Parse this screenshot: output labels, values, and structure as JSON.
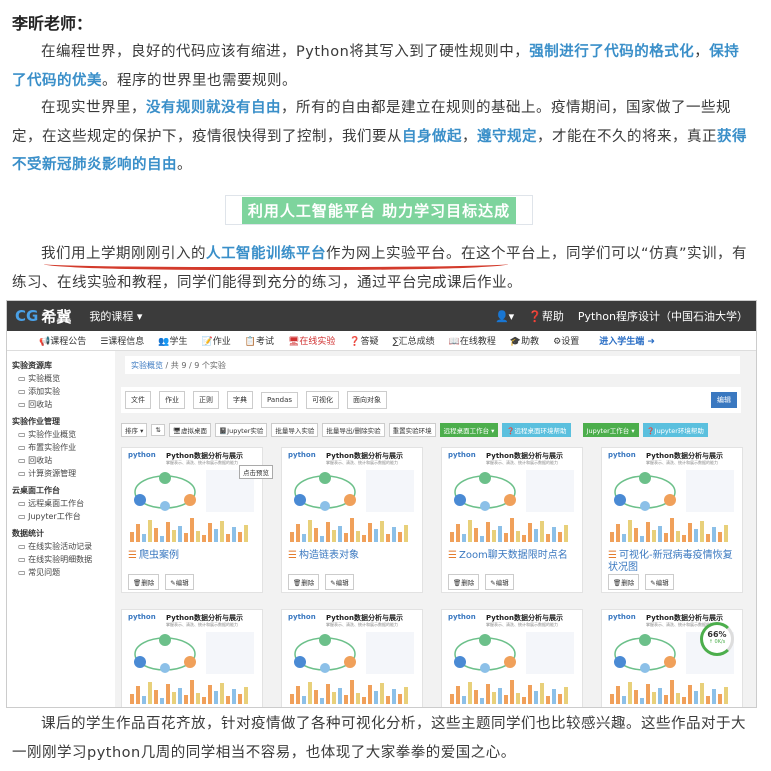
{
  "heading": "李昕老师：",
  "p1": {
    "pre": "在编程世界，良好的代码应该有缩进，Python将其写入到了硬性规则中，",
    "hl1": "强制进行了代码的格式化",
    "mid": "，",
    "hl2": "保持了代码的优美",
    "post": "。程序的世界里也需要规则。"
  },
  "p2": {
    "a": "在现实世界里，",
    "hl1": "没有规则就没有自由",
    "b": "，所有的自由都是建立在规则的基础上。疫情期间，国家做了一些规定，在这些规定的保护下，疫情很快得到了控制，我们要从",
    "hl2": "自身做起",
    "c": "，",
    "hl3": "遵守规定",
    "d": "，才能在不久的将来，真正",
    "hl4": "获得不受新冠肺炎影响的自由",
    "e": "。"
  },
  "section_title": "利用人工智能平台 助力学习目标达成",
  "p3": {
    "a": "我们用上学期刚刚引入的",
    "hl1": "人工智能训练平台",
    "b": "作为网上实验平台。在这个平台上，同学们可以“仿真”实训，有练习、在线实验和教程，同学们能得到充分的练习，通过平台完成课后作业。"
  },
  "p4": "课后的学生作品百花齐放，针对疫情做了各种可视化分析，这些主题同学们也比较感兴趣。这些作品对于大一刚刚学习python几周的同学相当不容易，也体现了大家拳拳的爱国之心。",
  "app": {
    "logo_mark": "CG",
    "logo_text": "希冀",
    "my_course": "我的课程 ▾",
    "user_icon": "user-icon",
    "help": "❓帮助",
    "course_name": "Python程序设计（中国石油大学）",
    "nav": [
      "📢课程公告",
      "☰课程信息",
      "👥学生",
      "📝作业",
      "📋考试",
      "🖥在线实验",
      "❓答疑",
      "∑汇总成绩",
      "📖在线教程",
      "🎓助教",
      "⚙设置"
    ],
    "nav_enter": "进入学生端 ➜",
    "sidebar": [
      {
        "title": "实验资源库",
        "items": [
          "实验概览",
          "添加实验",
          "回收站"
        ]
      },
      {
        "title": "实验作业管理",
        "items": [
          "实验作业概览",
          "布置实验作业",
          "回收站",
          "计算资源管理"
        ]
      },
      {
        "title": "云桌面工作台",
        "items": [
          "远程桌面工作台",
          "Jupyter工作台"
        ]
      },
      {
        "title": "数据统计",
        "items": [
          "在线实验活动记录",
          "在线实验明细数据",
          "常见问题"
        ]
      }
    ],
    "crumb_link": "实验概览",
    "crumb_rest": " / 共 9 / 9 个实验",
    "filters": [
      "文件",
      "作业",
      "正则",
      "字典",
      "Pandas",
      "可视化",
      "面向对象"
    ],
    "edit": "编辑",
    "tools": [
      "排序 ▾",
      "⇅",
      "🖥虚拟桌面",
      "📓Jupyter实验",
      "批量导入实验",
      "批量导出/删除实验",
      "重置实验环境"
    ],
    "tool_green1": "远程桌面工作台 ▾",
    "tool_blue1": "❓远程桌面环境帮助",
    "tool_green2": "Jupyter工作台 ▾",
    "tool_blue2": "❓Jupyter环境帮助",
    "tooltip": "点击预览",
    "thumb_logo": "python",
    "thumb_title": "Python数据分析与展示",
    "thumb_sub": "掌握表示、清洗、统计和展示数据的能力",
    "cards": [
      {
        "title": "爬虫案例",
        "del": "🗑删除",
        "edit": "✎编辑"
      },
      {
        "title": "构造链表对象",
        "del": "🗑删除",
        "edit": "✎编辑"
      },
      {
        "title": "Zoom聊天数据限时点名",
        "del": "🗑删除",
        "edit": "✎编辑"
      },
      {
        "title": "可视化-新冠病毒疫情恢复状况图",
        "del": "🗑删除",
        "edit": "✎编辑"
      }
    ],
    "progress": "66%",
    "progress_sub": "↑ 0K/s"
  }
}
